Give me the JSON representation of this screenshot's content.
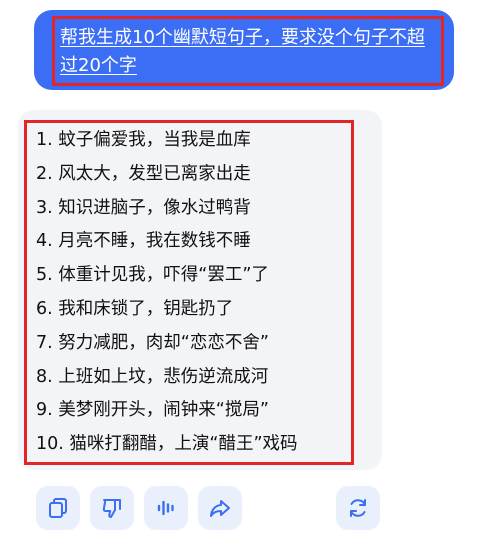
{
  "chat": {
    "user_message": "帮我生成10个幽默短句子，要求没个句子不超过20个字",
    "reply_lines": [
      "1. 蚊子偏爱我，当我是血库",
      "2. 风太大，发型已离家出走",
      "3. 知识进脑子，像水过鸭背",
      "4. 月亮不睡，我在数钱不睡",
      "5. 体重计见我，吓得“罢工”了",
      "6. 我和床锁了，钥匙扔了",
      "7. 努力减肥，肉却“恋恋不舍”",
      "8. 上班如上坟，悲伤逆流成河",
      "9. 美梦刚开头，闹钟来“搅局”",
      "10. 猫咪打翻醋，上演“醋王”戏码"
    ]
  },
  "actions": [
    {
      "icon": "copy-icon"
    },
    {
      "icon": "thumbs-down-icon"
    },
    {
      "icon": "voice-icon"
    },
    {
      "icon": "share-icon"
    },
    {
      "icon": "refresh-icon"
    }
  ],
  "colors": {
    "user_bubble": "#3b6ef5",
    "highlight_box": "#e02626",
    "card_bg": "#f3f4f8",
    "action_bg": "#eaf0fb",
    "icon": "#3b6ef5"
  }
}
